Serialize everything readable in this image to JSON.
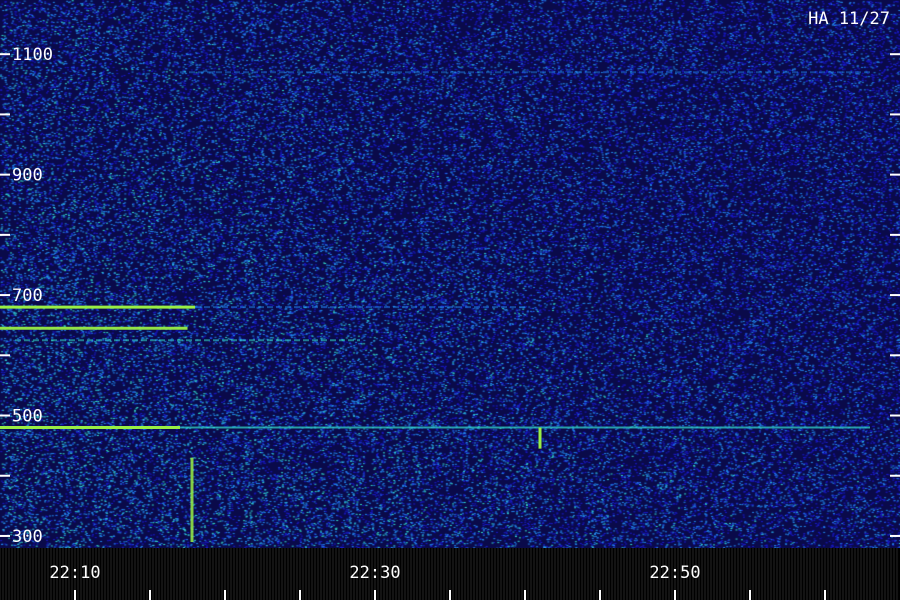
{
  "chart_data": {
    "type": "heatmap",
    "title": "",
    "corner_label": "HA 11/27",
    "xlabel": "",
    "ylabel": "",
    "x_ticks": [
      "22:10",
      "22:30",
      "22:50"
    ],
    "y_ticks": [
      "1100",
      "900",
      "700",
      "500",
      "300"
    ],
    "ylim": [
      280,
      1190
    ],
    "xlim_minutes": [
      0,
      60
    ],
    "colormap": {
      "background": "#0a0a4a",
      "low": "#1a1acc",
      "mid": "#2288ee",
      "high": "#33ddcc",
      "peak": "#99ee44"
    },
    "emission_lines": [
      {
        "freq": 1070,
        "start_min": 12,
        "end_min": 58,
        "strength": 0.4
      },
      {
        "freq": 680,
        "start_min": 0,
        "end_min": 13,
        "strength": 1.0
      },
      {
        "freq": 680,
        "start_min": 13,
        "end_min": 35,
        "strength": 0.5
      },
      {
        "freq": 645,
        "start_min": 0,
        "end_min": 12.5,
        "strength": 0.95
      },
      {
        "freq": 625,
        "start_min": 1,
        "end_min": 24,
        "strength": 0.55
      },
      {
        "freq": 480,
        "start_min": 0,
        "end_min": 12,
        "strength": 1.0
      },
      {
        "freq": 480,
        "start_min": 12,
        "end_min": 58,
        "strength": 0.7
      }
    ],
    "vertical_bursts": [
      {
        "time_min": 12.8,
        "freq_low": 290,
        "freq_high": 430,
        "strength": 0.85
      },
      {
        "time_min": 36,
        "freq_low": 445,
        "freq_high": 480,
        "strength": 1.0
      }
    ]
  }
}
